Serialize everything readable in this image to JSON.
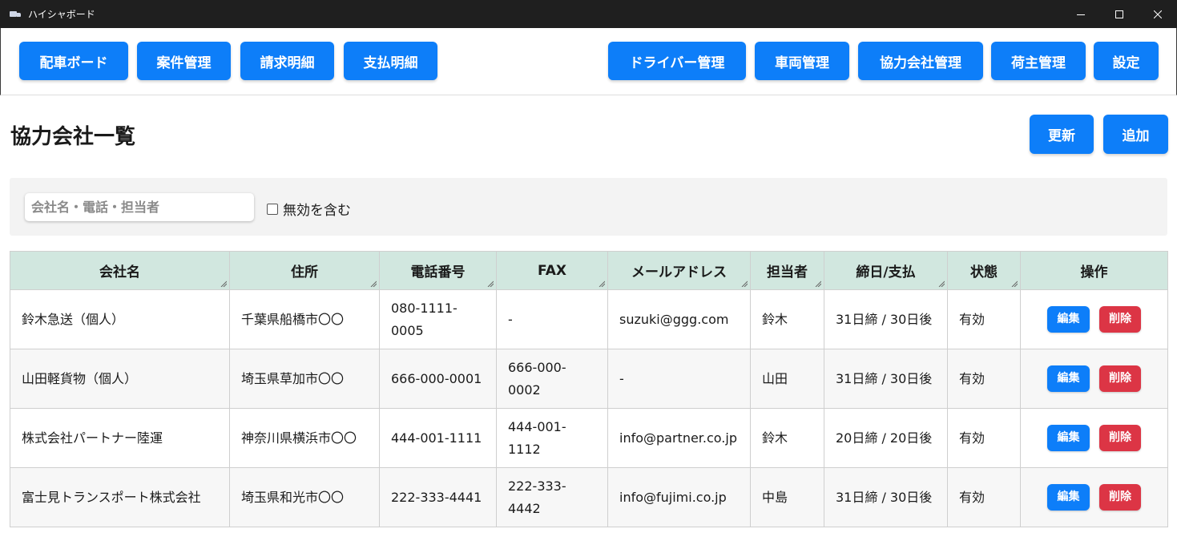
{
  "window": {
    "title": "ハイシャボード"
  },
  "nav": {
    "left": [
      {
        "label": "配車ボード"
      },
      {
        "label": "案件管理"
      },
      {
        "label": "請求明細"
      },
      {
        "label": "支払明細"
      }
    ],
    "right": [
      {
        "label": "ドライバー管理"
      },
      {
        "label": "車両管理"
      },
      {
        "label": "協力会社管理"
      },
      {
        "label": "荷主管理"
      },
      {
        "label": "設定"
      }
    ]
  },
  "page": {
    "title": "協力会社一覧",
    "refresh_label": "更新",
    "add_label": "追加"
  },
  "filter": {
    "search_placeholder": "会社名・電話・担当者",
    "search_value": "",
    "include_inactive_label": "無効を含む",
    "include_inactive_checked": false
  },
  "table": {
    "columns": [
      "会社名",
      "住所",
      "電話番号",
      "FAX",
      "メールアドレス",
      "担当者",
      "締日/支払",
      "状態",
      "操作"
    ],
    "rows": [
      {
        "company": "鈴木急送（個人）",
        "address": "千葉県船橋市〇〇",
        "phone": "080-1111-0005",
        "fax": "-",
        "email": "suzuki@ggg.com",
        "contact": "鈴木",
        "terms": "31日締 / 30日後",
        "status": "有効"
      },
      {
        "company": "山田軽貨物（個人）",
        "address": "埼玉県草加市〇〇",
        "phone": "666-000-0001",
        "fax": "666-000-0002",
        "email": "-",
        "contact": "山田",
        "terms": "31日締 / 30日後",
        "status": "有効"
      },
      {
        "company": "株式会社パートナー陸運",
        "address": "神奈川県横浜市〇〇",
        "phone": "444-001-1111",
        "fax": "444-001-1112",
        "email": "info@partner.co.jp",
        "contact": "鈴木",
        "terms": "20日締 / 20日後",
        "status": "有効"
      },
      {
        "company": "富士見トランスポート株式会社",
        "address": "埼玉県和光市〇〇",
        "phone": "222-333-4441",
        "fax": "222-333-4442",
        "email": "info@fujimi.co.jp",
        "contact": "中島",
        "terms": "31日締 / 30日後",
        "status": "有効"
      }
    ],
    "edit_label": "編集",
    "delete_label": "削除"
  },
  "colors": {
    "primary": "#0d7ef9",
    "danger": "#dc3545",
    "header_bg": "#d1e7df",
    "status_active": "#1b8a1b"
  },
  "icons": [
    "truck-icon",
    "minimize-icon",
    "maximize-icon",
    "close-icon",
    "resize-grip-icon"
  ]
}
